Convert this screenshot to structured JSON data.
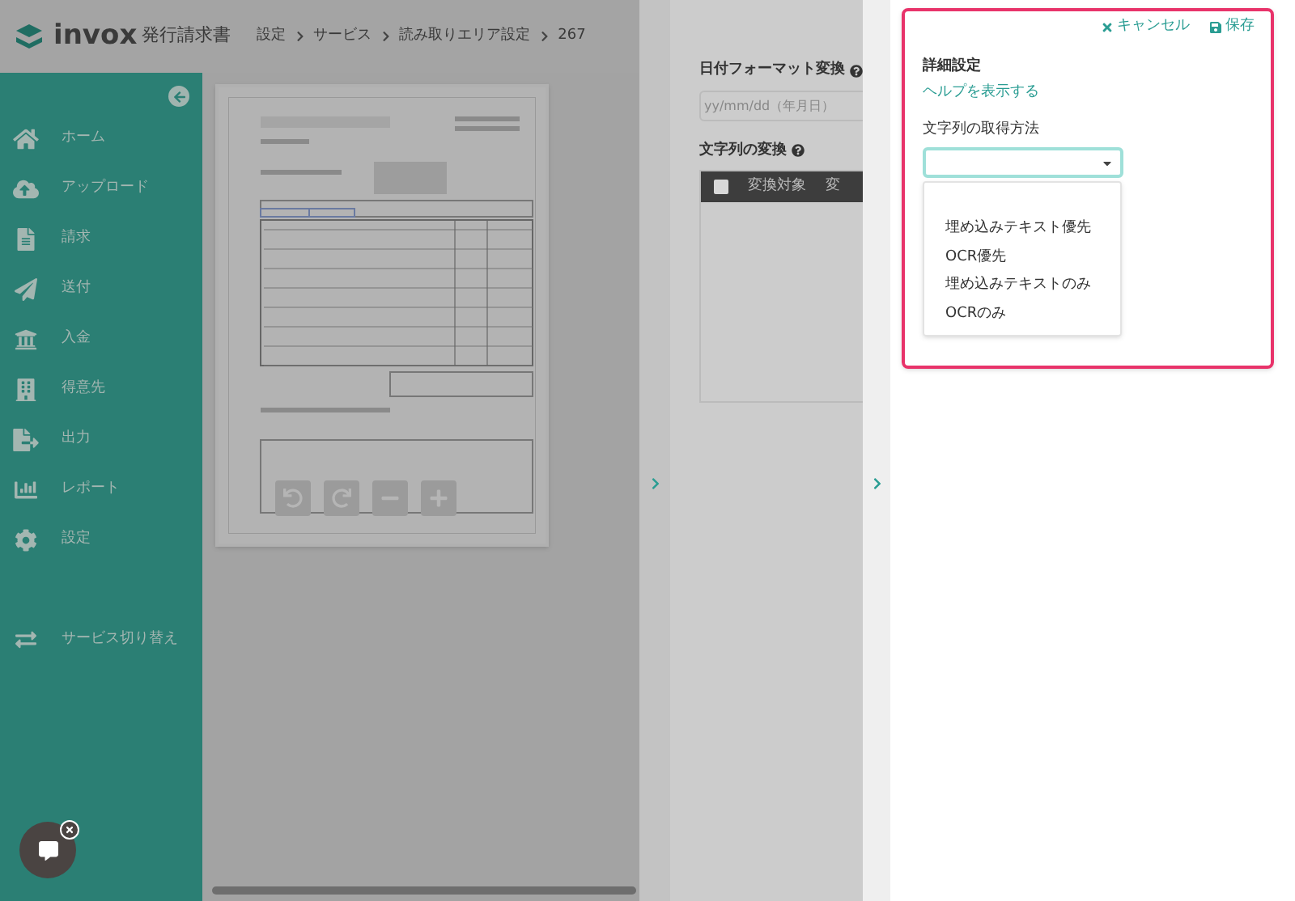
{
  "header": {
    "logo": "invox",
    "product": "発行請求書",
    "breadcrumbs": [
      "設定",
      "サービス",
      "読み取りエリア設定",
      "267"
    ]
  },
  "sidebar": {
    "items": [
      {
        "label": "ホーム"
      },
      {
        "label": "アップロード"
      },
      {
        "label": "請求"
      },
      {
        "label": "送付"
      },
      {
        "label": "入金"
      },
      {
        "label": "得意先"
      },
      {
        "label": "出力"
      },
      {
        "label": "レポート"
      },
      {
        "label": "設定"
      }
    ],
    "switch_service": "サービス切り替え"
  },
  "conversion_panel": {
    "date_format": {
      "label": "日付フォーマット変換",
      "placeholder": "yy/mm/dd（年月日）"
    },
    "string_conversion": {
      "label": "文字列の変換",
      "columns": [
        "変換対象",
        "変"
      ],
      "select_all_checked": false
    }
  },
  "detail_panel": {
    "cancel": "キャンセル",
    "save": "保存",
    "title": "詳細設定",
    "help_link": "ヘルプを表示する",
    "field_label": "文字列の取得方法",
    "options": [
      "埋め込みテキスト優先",
      "OCR優先",
      "埋め込みテキストのみ",
      "OCRのみ"
    ]
  }
}
